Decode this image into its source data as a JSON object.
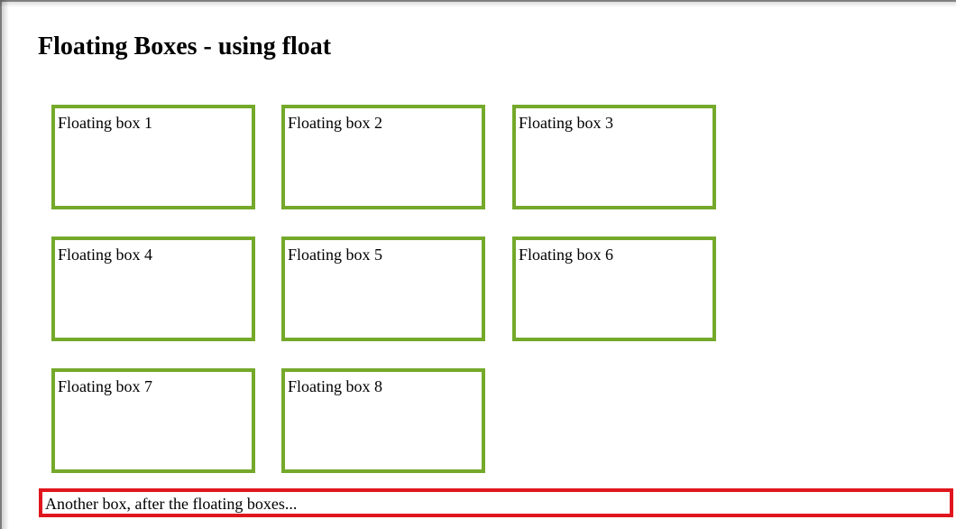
{
  "page": {
    "title": "Floating Boxes - using float"
  },
  "floating_boxes": [
    {
      "label": "Floating box 1"
    },
    {
      "label": "Floating box 2"
    },
    {
      "label": "Floating box 3"
    },
    {
      "label": "Floating box 4"
    },
    {
      "label": "Floating box 5"
    },
    {
      "label": "Floating box 6"
    },
    {
      "label": "Floating box 7"
    },
    {
      "label": "Floating box 8"
    }
  ],
  "after_box": {
    "label": "Another box, after the floating boxes..."
  },
  "colors": {
    "floating_border": "#74a92a",
    "after_border": "#e0161e",
    "background": "#ffffff",
    "text": "#000000"
  }
}
